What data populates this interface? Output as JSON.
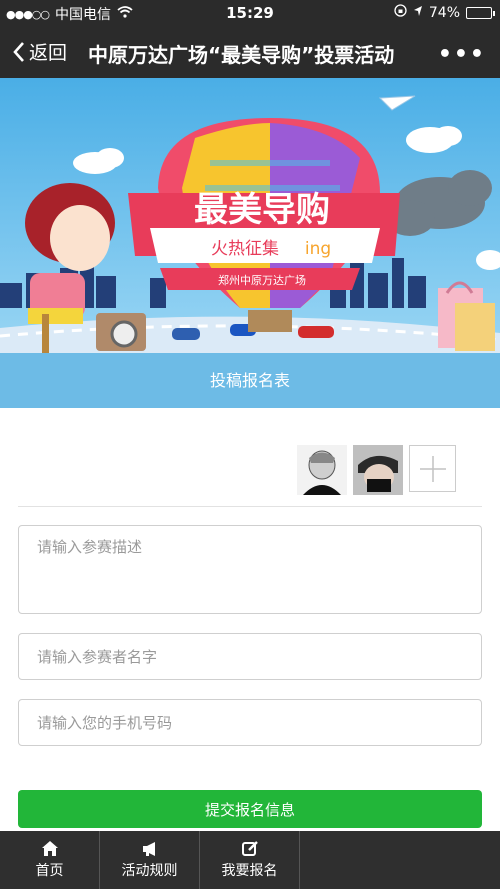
{
  "status_bar": {
    "carrier": "中国电信",
    "time": "15:29",
    "battery": "74%",
    "battery_level": 0.74
  },
  "nav": {
    "back_label": "返回",
    "title": "中原万达广场“最美导购”投票活动",
    "more_label": "•••"
  },
  "banner": {
    "headline": "最美导购",
    "subline_prefix": "火热征集",
    "subline_suffix": "ing",
    "brand": "郑州中原万达广场"
  },
  "form": {
    "band_title": "投稿报名表",
    "desc_placeholder": "请输入参赛描述",
    "name_placeholder": "请输入参赛者名字",
    "phone_placeholder": "请输入您的手机号码",
    "submit_label": "提交报名信息"
  },
  "tabs": [
    {
      "label": "首页",
      "icon": "home-icon"
    },
    {
      "label": "活动规则",
      "icon": "megaphone-icon"
    },
    {
      "label": "我要报名",
      "icon": "edit-icon"
    }
  ],
  "colors": {
    "bar_dark": "#2b2b2b",
    "band_blue": "#6dbbe6",
    "submit_green": "#22b639"
  }
}
